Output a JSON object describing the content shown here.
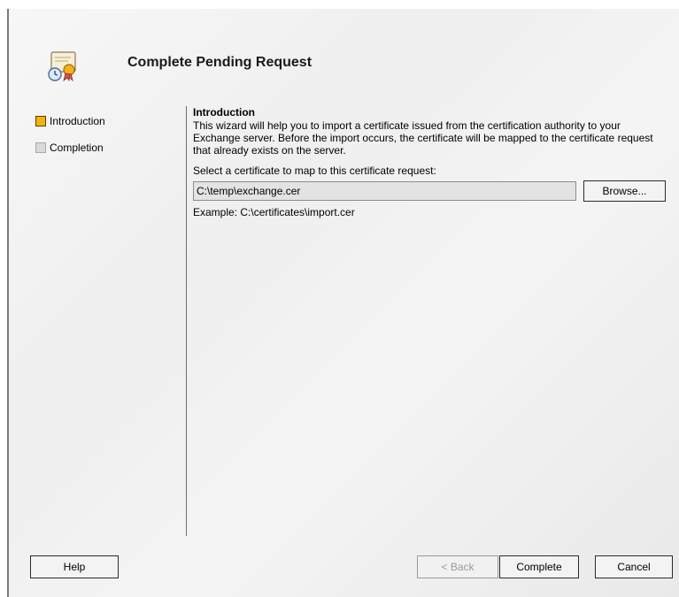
{
  "header": {
    "title": "Complete Pending Request",
    "icon": "certificate-icon"
  },
  "nav": {
    "items": [
      {
        "label": "Introduction",
        "state": "active",
        "color": "#f2b310"
      },
      {
        "label": "Completion",
        "state": "inactive",
        "color": "#d9d9d9"
      }
    ]
  },
  "content": {
    "section_title": "Introduction",
    "intro_text": "This wizard will help you to import a certificate issued from the certification authority to your Exchange server. Before the import occurs, the certificate will be mapped to the certificate request that already exists on the server.",
    "select_label": "Select a certificate to map to this certificate request:",
    "path_value": "C:\\temp\\exchange.cer",
    "browse_label": "Browse...",
    "example_text": "Example: C:\\certificates\\import.cer"
  },
  "footer": {
    "help_label": "Help",
    "back_label": "< Back",
    "complete_label": "Complete",
    "cancel_label": "Cancel"
  }
}
